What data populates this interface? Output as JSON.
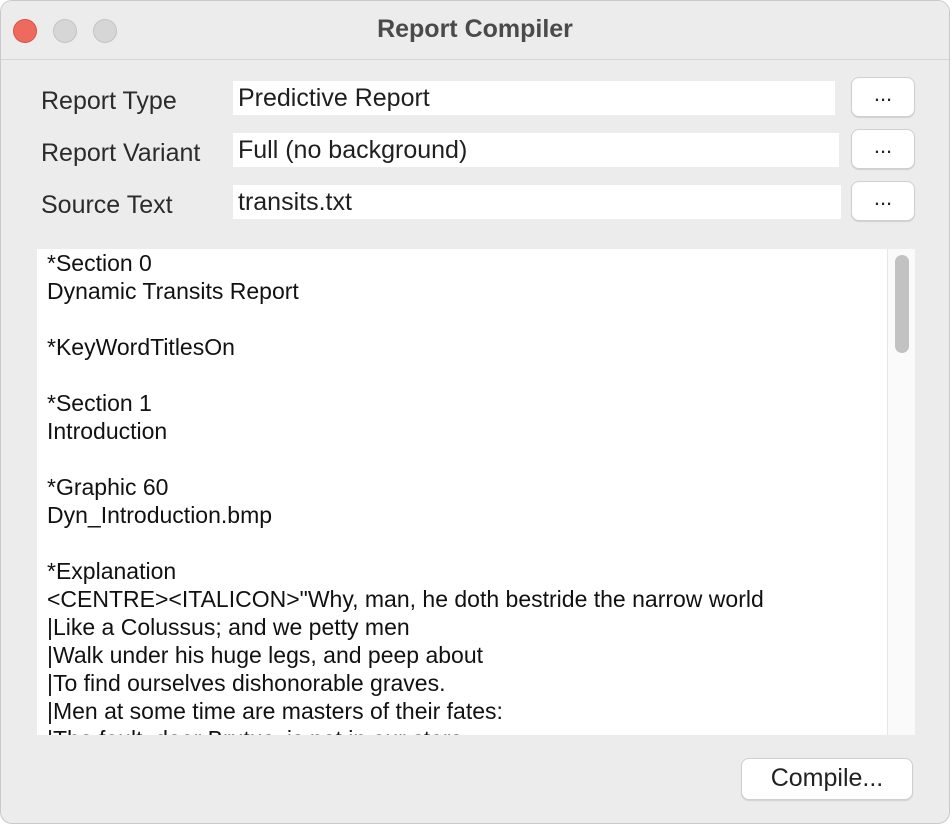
{
  "window": {
    "title": "Report Compiler"
  },
  "form": {
    "rows": [
      {
        "label": "Report Type",
        "value": "Predictive Report",
        "button": "..."
      },
      {
        "label": "Report Variant",
        "value": "Full (no background)",
        "button": "..."
      },
      {
        "label": "Source Text",
        "value": "transits.txt",
        "button": "..."
      }
    ]
  },
  "editor": {
    "lines": [
      "*Section 0",
      "Dynamic Transits Report",
      "",
      "*KeyWordTitlesOn",
      "",
      "*Section 1",
      "Introduction",
      "",
      "*Graphic 60",
      "Dyn_Introduction.bmp",
      "",
      "*Explanation",
      "<CENTRE><ITALICON>\"Why, man, he doth bestride the narrow world",
      "|Like a Colussus; and we petty men",
      "|Walk under his huge legs, and peep about",
      "|To find ourselves dishonorable graves.",
      "|Men at some time are masters of their fates:",
      "|The fault, dear Brutus, is not in our stars,"
    ]
  },
  "footer": {
    "compile_label": "Compile..."
  },
  "colors": {
    "close_button": "#ee6a5e",
    "window_background": "#ececec",
    "field_background": "#ffffff"
  }
}
